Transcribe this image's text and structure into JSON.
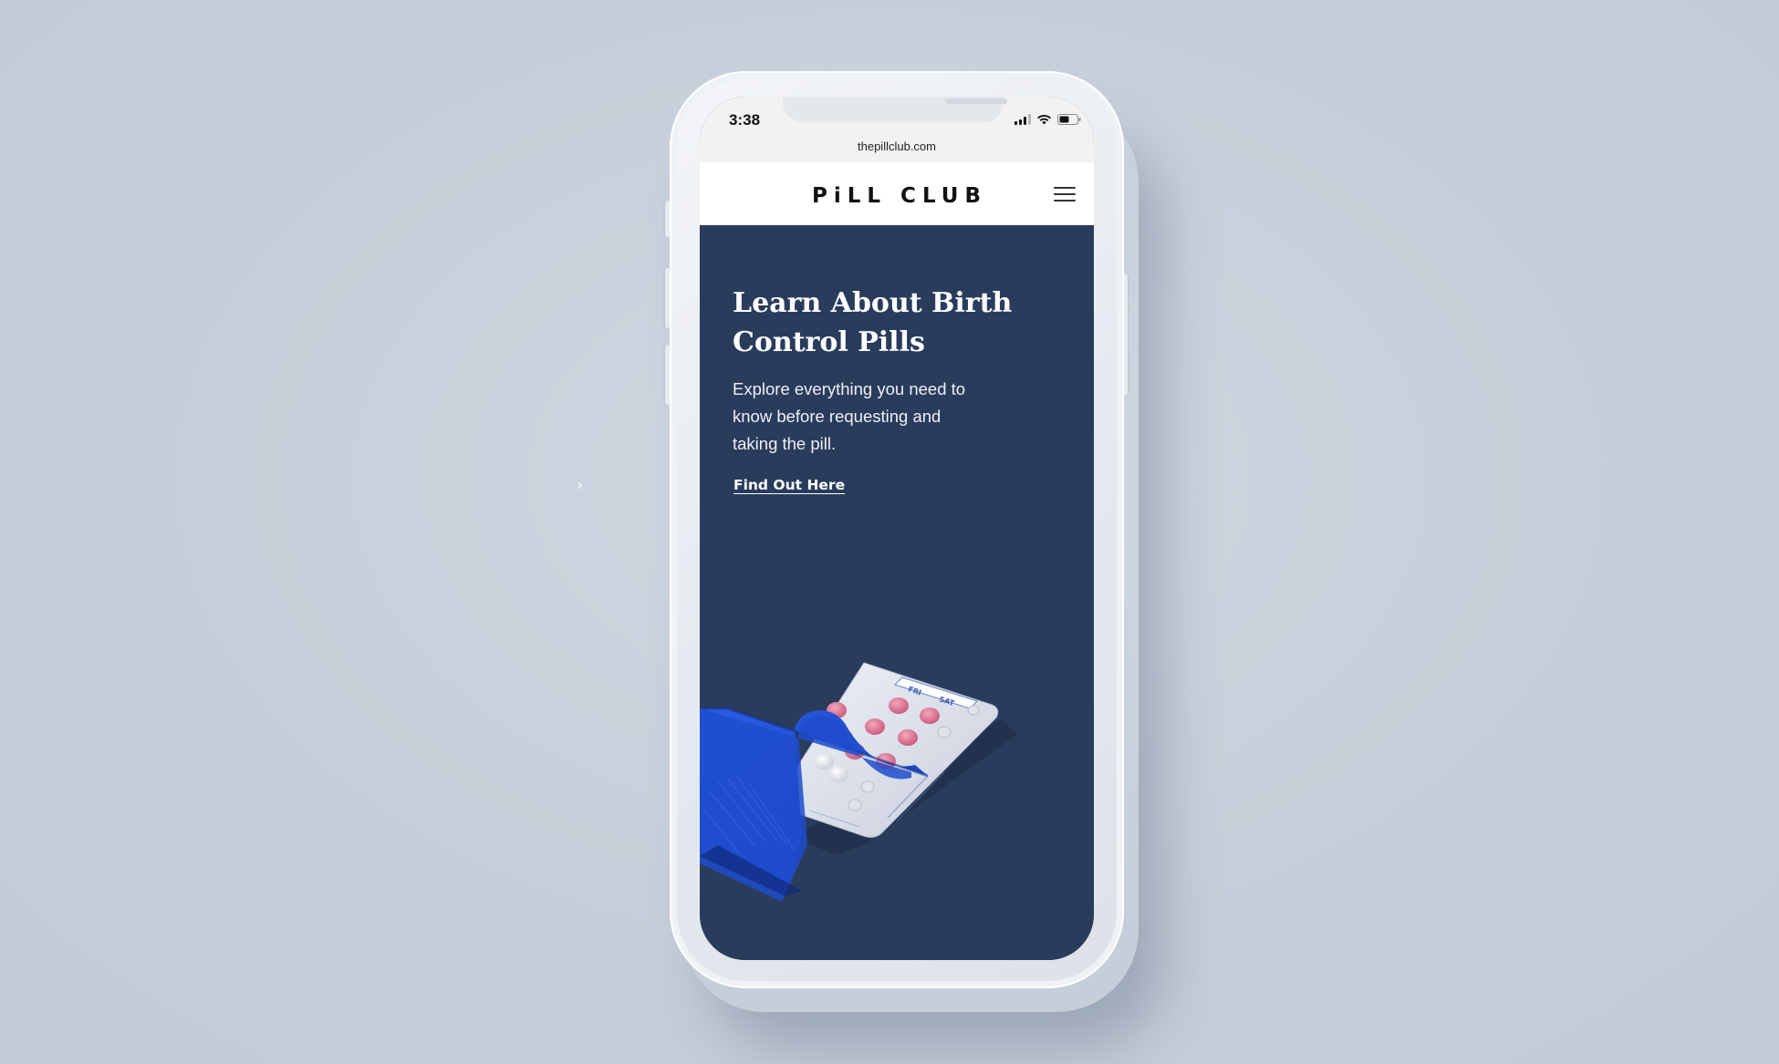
{
  "status_bar": {
    "time": "3:38",
    "url": "thepillclub.com"
  },
  "header": {
    "logo": "PiLL CLUB",
    "menu_icon": "hamburger-icon"
  },
  "hero": {
    "title": "Learn About Birth Control Pills",
    "description": "Explore everything you need to know before requesting and taking the pill.",
    "link_label": "Find Out Here",
    "image_icon": "pill-pack-illustration"
  },
  "pill_pack": {
    "day_labels": [
      "FRI",
      "SAT"
    ]
  },
  "colors": {
    "hero_background": "#2a3c5c",
    "sleeve_blue": "#1f4fd1",
    "page_background": "#c9d1dc"
  }
}
